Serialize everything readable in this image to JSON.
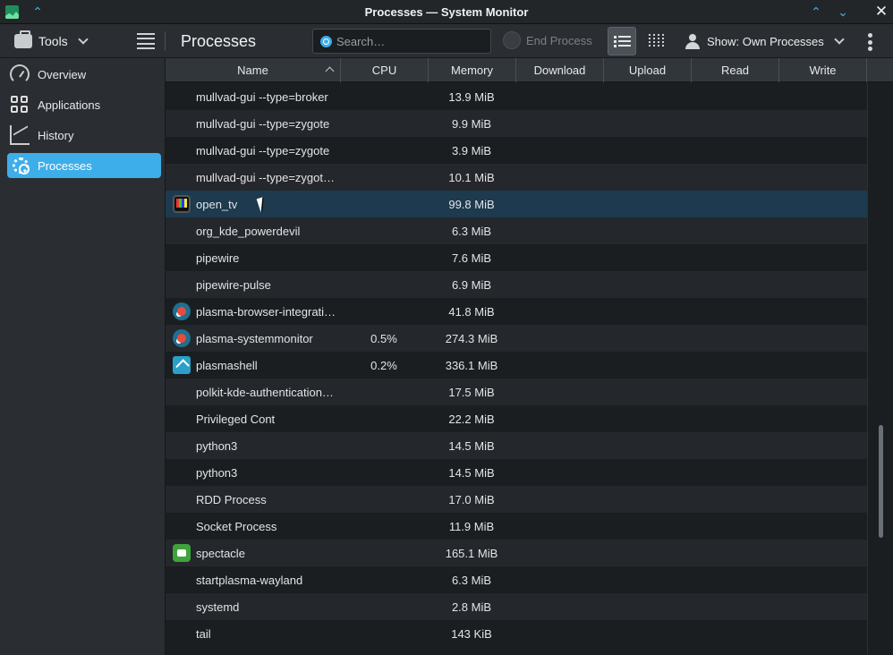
{
  "window": {
    "title": "Processes — System Monitor"
  },
  "toolbar": {
    "tools_label": "Tools",
    "page_title": "Processes",
    "search_placeholder": "Search…",
    "end_process_label": "End Process",
    "show_label": "Show: Own Processes"
  },
  "sidebar": {
    "items": [
      {
        "label": "Overview",
        "icon": "gauge-icon",
        "active": false
      },
      {
        "label": "Applications",
        "icon": "apps-grid-icon",
        "active": false
      },
      {
        "label": "History",
        "icon": "history-chart-icon",
        "active": false
      },
      {
        "label": "Processes",
        "icon": "gear-icon",
        "active": true
      }
    ]
  },
  "table": {
    "columns": [
      "Name",
      "CPU",
      "Memory",
      "Download",
      "Upload",
      "Read",
      "Write"
    ],
    "sort": {
      "column": "Name",
      "direction": "ascending"
    },
    "rows": [
      {
        "name": "mullvad-gui --type=broker",
        "cpu": "",
        "memory": "13.9 MiB",
        "icon": ""
      },
      {
        "name": "mullvad-gui --type=zygote",
        "cpu": "",
        "memory": "9.9 MiB",
        "icon": ""
      },
      {
        "name": "mullvad-gui --type=zygote",
        "cpu": "",
        "memory": "3.9 MiB",
        "icon": ""
      },
      {
        "name": "mullvad-gui --type=zygot…",
        "cpu": "",
        "memory": "10.1 MiB",
        "icon": ""
      },
      {
        "name": "open_tv",
        "cpu": "",
        "memory": "99.8 MiB",
        "icon": "tv-icon",
        "selected": true
      },
      {
        "name": "org_kde_powerdevil",
        "cpu": "",
        "memory": "6.3 MiB",
        "icon": ""
      },
      {
        "name": "pipewire",
        "cpu": "",
        "memory": "7.6 MiB",
        "icon": ""
      },
      {
        "name": "pipewire-pulse",
        "cpu": "",
        "memory": "6.9 MiB",
        "icon": ""
      },
      {
        "name": "plasma-browser-integrati…",
        "cpu": "",
        "memory": "41.8 MiB",
        "icon": "plasma-icon"
      },
      {
        "name": "plasma-systemmonitor",
        "cpu": "0.5%",
        "memory": "274.3 MiB",
        "icon": "plasma-icon"
      },
      {
        "name": "plasmashell",
        "cpu": "0.2%",
        "memory": "336.1 MiB",
        "icon": "plasmashell-icon"
      },
      {
        "name": "polkit-kde-authentication…",
        "cpu": "",
        "memory": "17.5 MiB",
        "icon": ""
      },
      {
        "name": "Privileged Cont",
        "cpu": "",
        "memory": "22.2 MiB",
        "icon": ""
      },
      {
        "name": "python3",
        "cpu": "",
        "memory": "14.5 MiB",
        "icon": ""
      },
      {
        "name": "python3",
        "cpu": "",
        "memory": "14.5 MiB",
        "icon": ""
      },
      {
        "name": "RDD Process",
        "cpu": "",
        "memory": "17.0 MiB",
        "icon": ""
      },
      {
        "name": "Socket Process",
        "cpu": "",
        "memory": "11.9 MiB",
        "icon": ""
      },
      {
        "name": "spectacle",
        "cpu": "",
        "memory": "165.1 MiB",
        "icon": "camera-icon"
      },
      {
        "name": "startplasma-wayland",
        "cpu": "",
        "memory": "6.3 MiB",
        "icon": ""
      },
      {
        "name": "systemd",
        "cpu": "",
        "memory": "2.8 MiB",
        "icon": ""
      },
      {
        "name": "tail",
        "cpu": "",
        "memory": "143 KiB",
        "icon": ""
      }
    ]
  },
  "colors": {
    "accent": "#3daee9",
    "selection": "#1d3a4f"
  }
}
